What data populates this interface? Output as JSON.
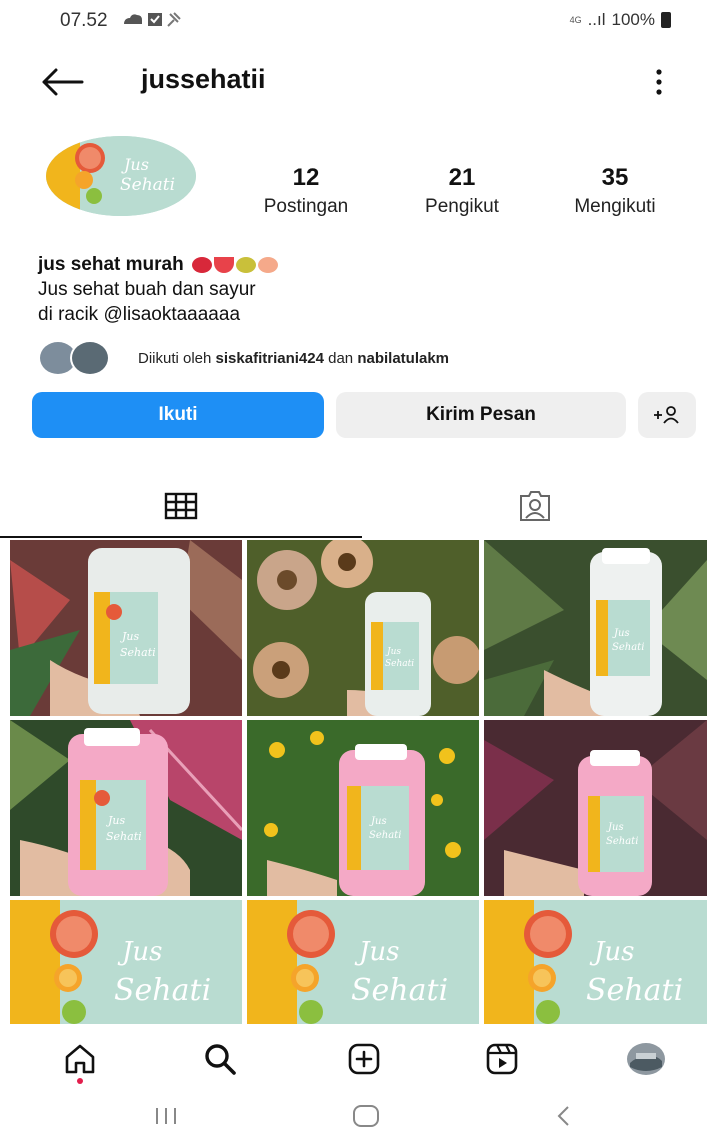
{
  "status_bar": {
    "time": "07.52",
    "network": "4G",
    "signal": "..ıl",
    "battery": "100%"
  },
  "header": {
    "username": "jussehatii"
  },
  "avatar": {
    "line1": "Jus",
    "line2": "Sehati"
  },
  "stats": [
    {
      "value": "12",
      "label": "Postingan"
    },
    {
      "value": "21",
      "label": "Pengikut"
    },
    {
      "value": "35",
      "label": "Mengikuti"
    }
  ],
  "bio": {
    "name": "jus sehat murah",
    "line2": "Jus sehat buah dan sayur",
    "line3": "di racik @lisaoktaaaaaa"
  },
  "followed_by": {
    "prefix": "Diikuti oleh",
    "user1": "siskafitriani424",
    "conj": "dan",
    "user2": "nabilatulakm"
  },
  "actions": {
    "follow": "Ikuti",
    "message": "Kirim Pesan",
    "add_user": "+°"
  },
  "grid": {
    "posts": [
      {
        "kind": "bottle-white",
        "bg": "#b64d4a"
      },
      {
        "kind": "bottle-white",
        "bg": "#6b7d3a"
      },
      {
        "kind": "bottle-white",
        "bg": "#4b6b3a"
      },
      {
        "kind": "bottle-pink",
        "bg": "#8a2f4a"
      },
      {
        "kind": "bottle-pink",
        "bg": "#3f7a2e"
      },
      {
        "kind": "bottle-pink",
        "bg": "#5a2d3a"
      },
      {
        "kind": "logo",
        "title1": "Jus",
        "title2": "Sehati"
      },
      {
        "kind": "logo",
        "title1": "Jus",
        "title2": "Sehati"
      },
      {
        "kind": "logo",
        "title1": "Jus",
        "title2": "Sehati"
      }
    ]
  },
  "colors": {
    "accent": "#1e8ff5",
    "notification": "#e21e4c",
    "logo_teal": "#b9dcd1",
    "logo_yellow": "#f1b51c"
  }
}
